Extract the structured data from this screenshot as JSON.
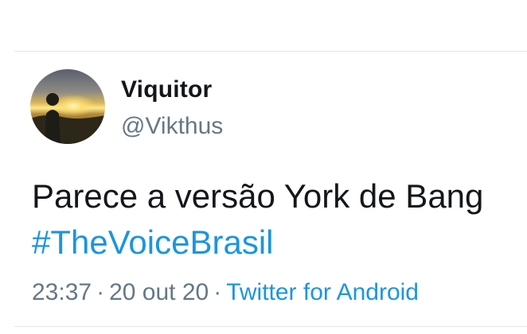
{
  "user": {
    "display_name": "Viquitor",
    "handle": "@Vikthus",
    "avatar": "sunset-photo-avatar"
  },
  "tweet": {
    "text_before": "Parece a versão York de Bang ",
    "hashtag": "#TheVoiceBrasil"
  },
  "meta": {
    "time": "23:37",
    "separator": "·",
    "date": "20 out 20",
    "source": "Twitter for Android"
  },
  "colors": {
    "link": "#1b95e0",
    "secondary": "#657786",
    "primary": "#14171a",
    "divider": "#e1e8ed"
  }
}
